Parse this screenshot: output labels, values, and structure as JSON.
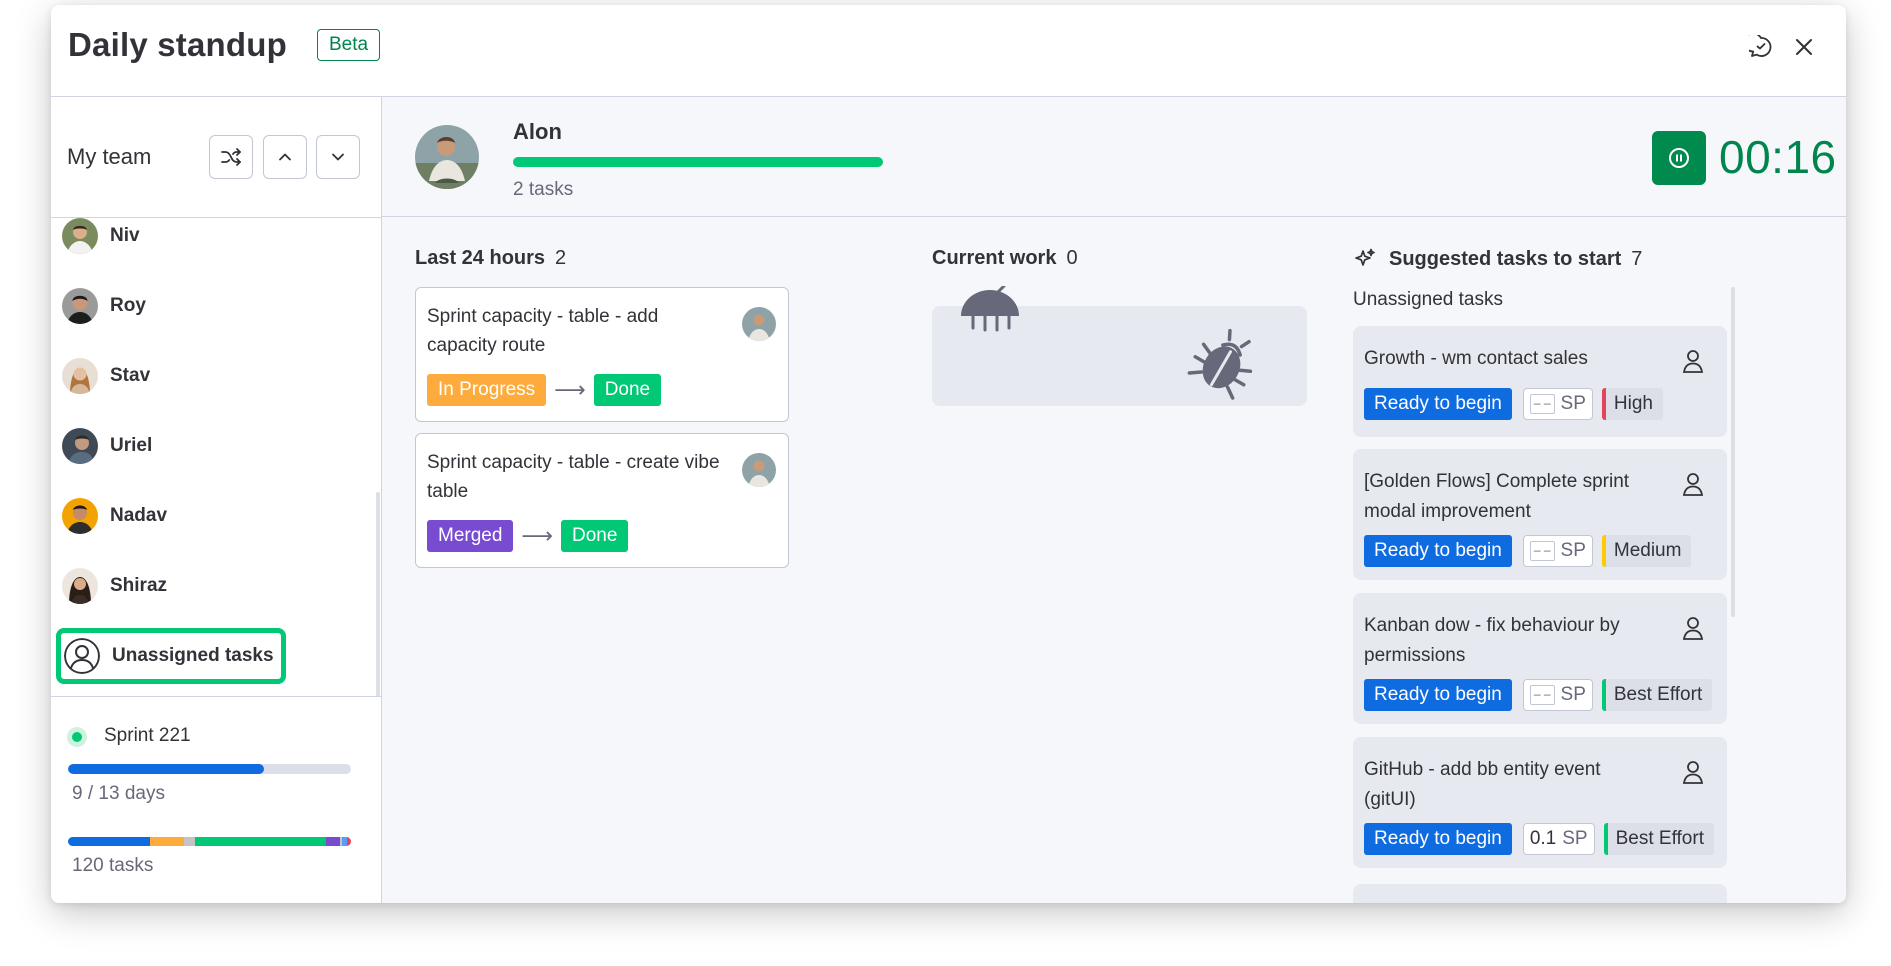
{
  "header": {
    "title": "Daily standup",
    "badge": "Beta",
    "feedback_icon": "feedback-chat-icon",
    "close_icon": "close-icon"
  },
  "sidebar": {
    "title": "My team",
    "controls": [
      "shuffle-icon",
      "chevron-up-icon",
      "chevron-down-icon"
    ],
    "members": [
      {
        "name": "Niv",
        "color": "#8d6e63"
      },
      {
        "name": "Roy",
        "color": "#3e3a36"
      },
      {
        "name": "Stav",
        "color": "#c8a27a"
      },
      {
        "name": "Uriel",
        "color": "#5d6670"
      },
      {
        "name": "Nadav",
        "color": "#f2a300"
      },
      {
        "name": "Shiraz",
        "color": "#4a3b33"
      },
      {
        "name": "Unassigned tasks",
        "color": "#ffffff"
      }
    ],
    "selected_member": "Unassigned tasks",
    "sprint": {
      "name": "Sprint 221",
      "progress": 0.692,
      "days": "9 / 13 days",
      "tasks": "120 tasks",
      "status_segments": [
        {
          "color": "#0f6ce0",
          "fraction": 0.29
        },
        {
          "color": "#fdab3d",
          "fraction": 0.12
        },
        {
          "color": "#c4c4c4",
          "fraction": 0.04
        },
        {
          "color": "#00c875",
          "fraction": 0.46
        },
        {
          "color": "#784bd1",
          "fraction": 0.05
        },
        {
          "color": "#c4c4c4",
          "fraction": 0.01
        },
        {
          "color": "#579bfc",
          "fraction": 0.015
        },
        {
          "color": "#e2445c",
          "fraction": 0.015
        }
      ]
    }
  },
  "person": {
    "name": "Alon",
    "tasks": "2 tasks",
    "progress": 1.0,
    "timer": "00:16",
    "pause_icon": "pause-icon"
  },
  "columns": {
    "last24": {
      "title": "Last 24 hours",
      "count": "2",
      "cards": [
        {
          "title": "Sprint capacity - table - add capacity route",
          "from": "In Progress",
          "from_color": "#fdab3d",
          "to": "Done",
          "to_color": "#00c875"
        },
        {
          "title": "Sprint capacity - table - create vibe table",
          "from": "Merged",
          "from_color": "#784bd1",
          "to": "Done",
          "to_color": "#00c875"
        }
      ]
    },
    "current": {
      "title": "Current work",
      "count": "0",
      "empty_icon": "bug-icon"
    },
    "suggested": {
      "title": "Suggested tasks to start",
      "count": "7",
      "title_icon": "sparkle-icon",
      "group_label": "Unassigned tasks",
      "cards": [
        {
          "title": "Growth - wm contact sales",
          "status": "Ready to begin",
          "sp": "",
          "sp_label": "SP",
          "priority": "High",
          "priority_color": "#e2445c"
        },
        {
          "title": "[Golden Flows] Complete sprint modal improvement",
          "status": "Ready to begin",
          "sp": "",
          "sp_label": "SP",
          "priority": "Medium",
          "priority_color": "#ffcb00"
        },
        {
          "title": "Kanban dow - fix behaviour by permissions",
          "status": "Ready to begin",
          "sp": "",
          "sp_label": "SP",
          "priority": "Best Effort",
          "priority_color": "#00c875"
        },
        {
          "title": "GitHub - add bb entity event (gitUI)",
          "status": "Ready to begin",
          "sp": "0.1",
          "sp_label": "SP",
          "priority": "Best Effort",
          "priority_color": "#00c875"
        }
      ]
    }
  }
}
